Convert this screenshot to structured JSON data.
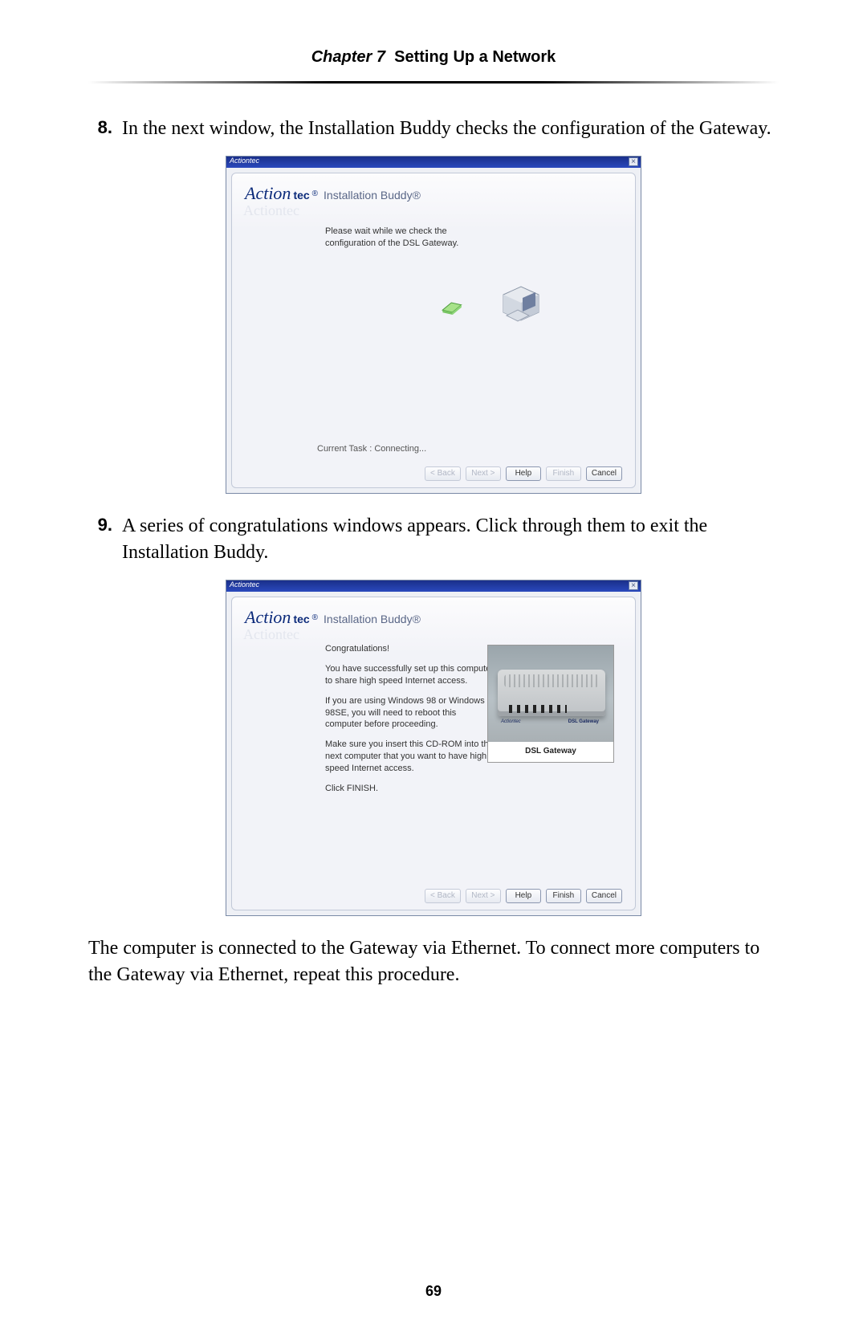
{
  "header": {
    "chapter_label": "Chapter 7",
    "title": "Setting Up a Network"
  },
  "steps": [
    {
      "num": "8.",
      "text": "In the next window, the Installation Buddy checks the configuration of the Gateway."
    },
    {
      "num": "9.",
      "text": "A series of congratulations windows appears. Click through them to exit the Installation Buddy."
    }
  ],
  "closing_paragraph": "The computer is connected to the Gateway via Ethernet. To connect more computers to the Gateway via Ethernet, repeat this procedure.",
  "app": {
    "titlebar_brand": "Actiontec",
    "close_glyph": "×",
    "logo_action": "Action",
    "logo_tec": "tec",
    "logo_reg": "®",
    "logo_ibuddy": "Installation Buddy®",
    "watermark": "Actiontec",
    "buttons": {
      "back": "< Back",
      "next": "Next >",
      "help": "Help",
      "finish": "Finish",
      "cancel": "Cancel"
    }
  },
  "window1": {
    "wait_text": "Please wait while we check the configuration of the DSL Gateway.",
    "current_task": "Current Task : Connecting..."
  },
  "window2": {
    "congrats": "Congratulations!",
    "p1": "You have successfully set up this computer to share high speed Internet access.",
    "p2": "If you are using Windows 98 or Windows 98SE, you will need to reboot this computer before proceeding.",
    "p3": "Make sure you insert this CD-ROM into the next computer that you want to have high speed Internet access.",
    "p4": "Click FINISH.",
    "photo_label_left": "Actiontec",
    "photo_label_right": "DSL Gateway",
    "photo_caption": "DSL Gateway"
  },
  "page_number": "69"
}
